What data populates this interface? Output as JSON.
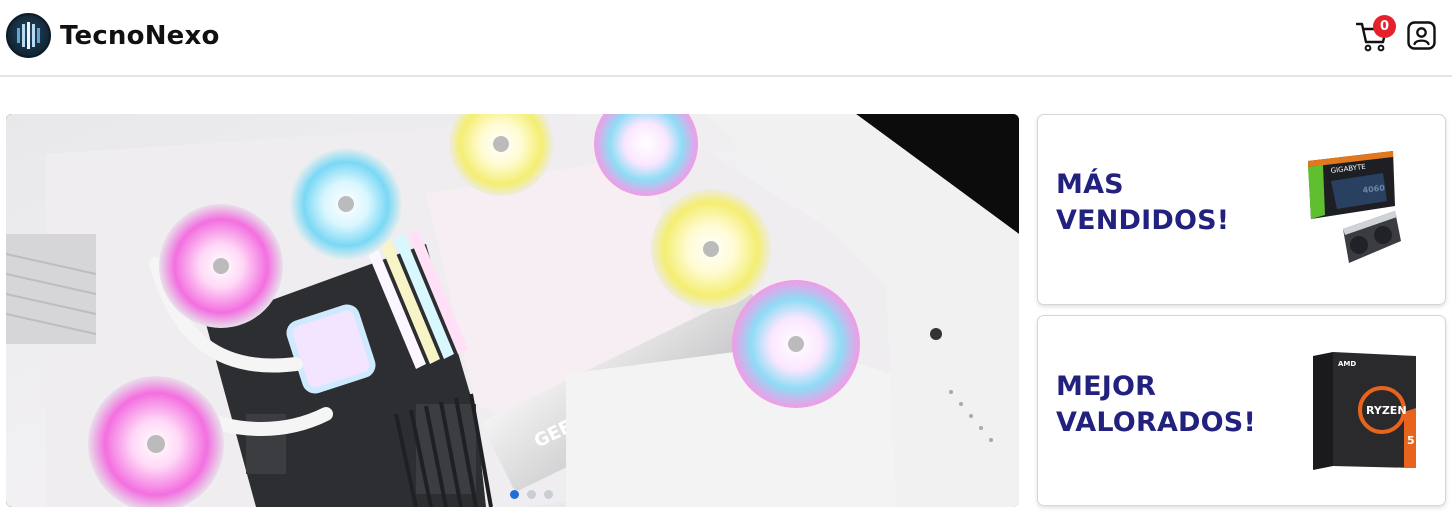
{
  "header": {
    "brand_name": "TecnoNexo",
    "cart_count": "0",
    "icons": {
      "logo": "tecnonexo-logo",
      "cart": "cart-icon",
      "user": "user-profile-icon"
    }
  },
  "hero": {
    "image": "white-pc-build-rgb-fans-geforce-rtx",
    "gpu_label": "GEFORCE RTX",
    "slides": 3,
    "active_slide": 1
  },
  "promos": [
    {
      "title_line1": "MÁS",
      "title_line2": "VENDIDOS!",
      "image": "gigabyte-geforce-rtx-4060-box-and-card"
    },
    {
      "title_line1": "MEJOR",
      "title_line2": "VALORADOS!",
      "image": "amd-ryzen-5-box"
    }
  ],
  "colors": {
    "promo_title": "#23217e",
    "badge": "#e5222b",
    "active_dot": "#1f6fd6"
  }
}
